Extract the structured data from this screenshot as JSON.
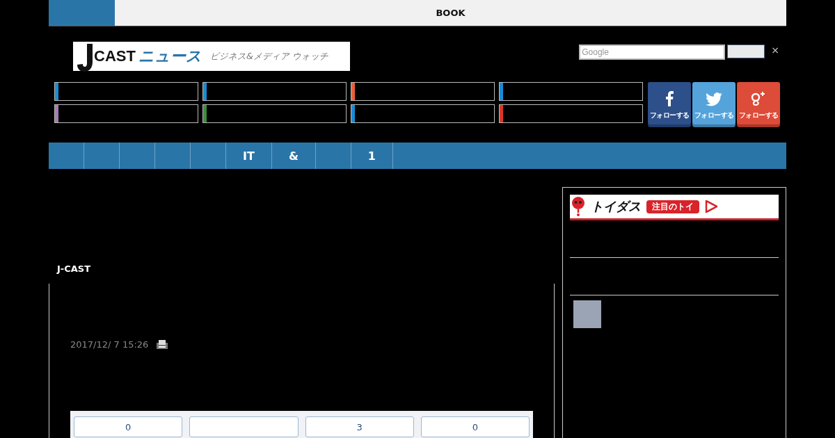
{
  "top_bar": {
    "label": "BOOK"
  },
  "logo": {
    "mark": "CAST",
    "name": "ニュース",
    "tagline": "ビジネス&メディア ウォッチ"
  },
  "search": {
    "placeholder": "Google",
    "close": "×"
  },
  "categories": [
    {
      "color": "#1a8ad4"
    },
    {
      "color": "#1a8ad4"
    },
    {
      "color": "#e8603c"
    },
    {
      "color": "#1a8ad4"
    },
    {
      "color": "#a37bb5"
    },
    {
      "color": "#3f8a3f"
    },
    {
      "color": "#1a8ad4"
    },
    {
      "color": "#d9362b"
    }
  ],
  "social": [
    {
      "kind": "facebook",
      "label": "フォローする"
    },
    {
      "kind": "twitter",
      "label": "フォローする"
    },
    {
      "kind": "googleplus",
      "label": "フォローする"
    }
  ],
  "nav": [
    {
      "kind": "blank"
    },
    {
      "kind": "blank"
    },
    {
      "kind": "blank"
    },
    {
      "kind": "blank"
    },
    {
      "kind": "blank"
    },
    {
      "kind": "text",
      "label": "IT"
    },
    {
      "kind": "text",
      "label": "&"
    },
    {
      "kind": "blank"
    },
    {
      "kind": "text",
      "label": "1"
    }
  ],
  "sidebar": {
    "banner": {
      "name": "トイダス",
      "badge": "注目のトイ"
    }
  },
  "article": {
    "source": "J-CAST",
    "date": "2017/12/ 7 15:26"
  },
  "reactions": [
    {
      "kind": "count",
      "count": "0"
    },
    {
      "kind": "blank"
    },
    {
      "kind": "count",
      "count": "3"
    },
    {
      "kind": "count",
      "count": "0"
    }
  ]
}
